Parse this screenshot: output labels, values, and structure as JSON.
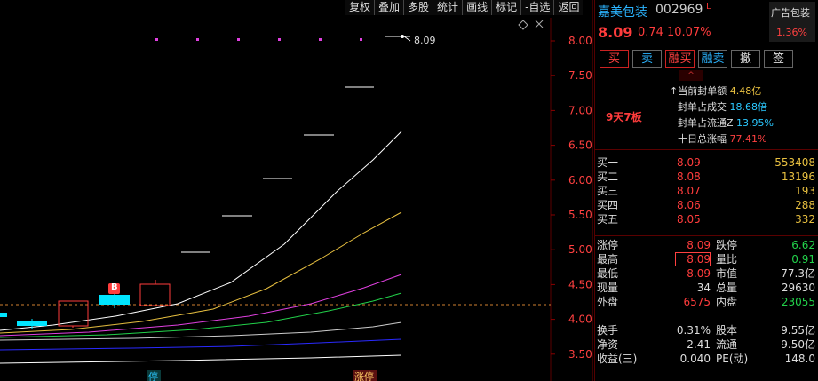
{
  "toolbar": [
    "复权",
    "叠加",
    "多股",
    "统计",
    "画线",
    "标记",
    "-自选",
    "返回"
  ],
  "chart": {
    "y_ticks": [
      "8.00",
      "7.50",
      "7.00",
      "6.50",
      "6.00",
      "5.50",
      "5.00",
      "4.50",
      "4.00",
      "3.50"
    ],
    "last_price_label": "8.09",
    "b_marker": "B",
    "bottom_tags": [
      "停",
      "涨停"
    ],
    "colors": {
      "up": "#ff3c3c",
      "down": "#00e5ff",
      "ma5": "#ffffff",
      "ma10": "#e8c040",
      "ma20": "#e040e0",
      "ma30": "#22d14a",
      "ma60": "#cccccc",
      "ma120": "#2a2aff"
    }
  },
  "quote": {
    "name": "嘉美包装",
    "code": "002969",
    "mark": "L",
    "price": "8.09",
    "change": "0.74",
    "change_pct": "10.07%",
    "ad_title": "广告包装",
    "ad_pct": "1.36%"
  },
  "buttons": [
    "买",
    "卖",
    "融买",
    "融卖",
    "撤",
    "签"
  ],
  "collapse": "^",
  "lianban": "9天7板",
  "seal": {
    "cur_label": "↑当前封单额",
    "cur_value": "4.48亿",
    "deal_label": "封单占成交",
    "deal_value": "18.68倍",
    "float_label": "封单占流通Z",
    "float_value": "13.95%",
    "ten_label": "十日总涨幅",
    "ten_value": "77.41%"
  },
  "orderbook": [
    {
      "label": "买一",
      "price": "8.09",
      "vol": "553408"
    },
    {
      "label": "买二",
      "price": "8.08",
      "vol": "13196"
    },
    {
      "label": "买三",
      "price": "8.07",
      "vol": "193"
    },
    {
      "label": "买四",
      "price": "8.06",
      "vol": "288"
    },
    {
      "label": "买五",
      "price": "8.05",
      "vol": "332"
    }
  ],
  "stats1": [
    {
      "l1": "涨停",
      "v1": "8.09",
      "l2": "跌停",
      "v2": "6.62"
    },
    {
      "l1": "最高",
      "v1": "8.09",
      "l2": "量比",
      "v2": "0.91"
    },
    {
      "l1": "最低",
      "v1": "8.09",
      "l2": "市值",
      "v2": "77.3亿"
    },
    {
      "l1": "现量",
      "v1": "34",
      "l2": "总量",
      "v2": "29630"
    },
    {
      "l1": "外盘",
      "v1": "6575",
      "l2": "内盘",
      "v2": "23055"
    }
  ],
  "stats2": [
    {
      "l1": "换手",
      "v1": "0.31%",
      "l2": "股本",
      "v2": "9.55亿"
    },
    {
      "l1": "净资",
      "v1": "2.41",
      "l2": "流通",
      "v2": "9.50亿"
    },
    {
      "l1": "收益(三)",
      "v1": "0.040",
      "l2": "PE(动)",
      "v2": "148.0"
    }
  ]
}
